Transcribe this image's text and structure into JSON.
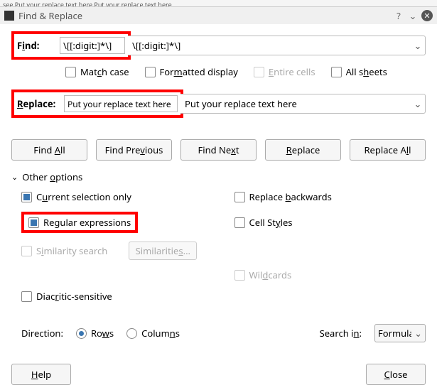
{
  "truncated_text": "see Put your replace text here  Put your replace text here",
  "window": {
    "title": "Find & Replace"
  },
  "find": {
    "label_pre": "F",
    "label_u": "i",
    "label_post": "nd:",
    "value": "\\[[:digit:]*\\]"
  },
  "replace": {
    "label_pre": "",
    "label_u": "R",
    "label_post": "eplace:",
    "value": "Put your replace text here"
  },
  "topchecks": {
    "match_case": {
      "pre": "Mat",
      "u": "c",
      "post": "h case",
      "checked": false
    },
    "formatted": {
      "pre": "For",
      "u": "m",
      "post": "atted display",
      "checked": false
    },
    "entire": {
      "pre": "",
      "u": "E",
      "post": "ntire cells",
      "checked": false
    },
    "allsheets": {
      "pre": "All s",
      "u": "h",
      "post": "eets",
      "checked": false
    }
  },
  "buttons": {
    "find_all": {
      "pre": "Find ",
      "u": "A",
      "post": "ll"
    },
    "find_prev": {
      "pre": "Find Pre",
      "u": "v",
      "post": "ious"
    },
    "find_next": {
      "pre": "Find Ne",
      "u": "x",
      "post": "t"
    },
    "replace": {
      "pre": "",
      "u": "R",
      "post": "eplace"
    },
    "replace_all": {
      "pre": "Replace A",
      "u": "l",
      "post": "l"
    },
    "similarities": {
      "pre": "Similaritie",
      "u": "s",
      "post": "..."
    },
    "help": {
      "pre": "",
      "u": "H",
      "post": "elp"
    },
    "close": {
      "pre": "",
      "u": "C",
      "post": "lose"
    }
  },
  "other": {
    "header": {
      "pre": "Other ",
      "u": "o",
      "post": "ptions"
    },
    "current_sel": {
      "pre": "C",
      "u": "u",
      "post": "rrent selection only",
      "checked": true
    },
    "regex": {
      "pre": "Re",
      "u": "g",
      "post": "ular expressions",
      "checked": true
    },
    "similarity": {
      "pre": "S",
      "u": "i",
      "post": "milarity search",
      "checked": false
    },
    "diacritic": {
      "pre": "Diac",
      "u": "r",
      "post": "itic-sensitive",
      "checked": false
    },
    "replace_back": {
      "pre": "Replace ",
      "u": "b",
      "post": "ackwards",
      "checked": false
    },
    "cell_styles": {
      "pre": "Cell St",
      "u": "y",
      "post": "les",
      "checked": false
    },
    "wildcards": {
      "pre": "Wil",
      "u": "d",
      "post": "cards",
      "checked": false
    }
  },
  "direction": {
    "label": "Direction:",
    "rows": {
      "pre": "Ro",
      "u": "w",
      "post": "s",
      "selected": true
    },
    "cols": {
      "pre": "Colum",
      "u": "n",
      "post": "s",
      "selected": false
    },
    "search_in": {
      "pre": "Search i",
      "u": "n",
      "post": ":"
    },
    "search_in_value": "Formulas"
  }
}
